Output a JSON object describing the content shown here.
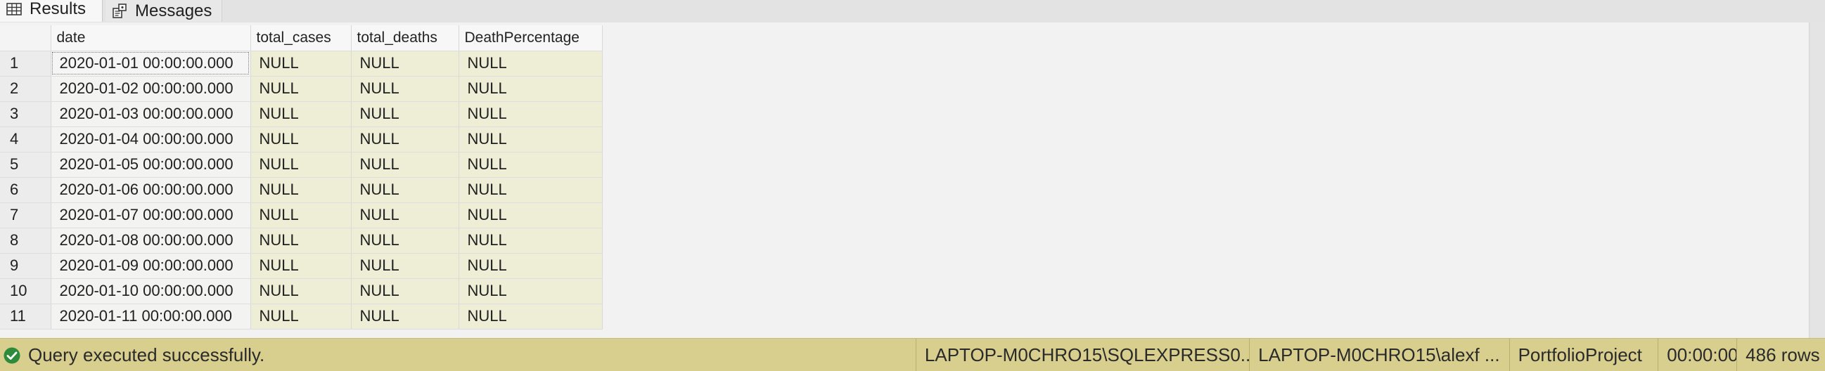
{
  "tabs": {
    "results_label": "Results",
    "messages_label": "Messages"
  },
  "grid": {
    "columns": [
      "date",
      "total_cases",
      "total_deaths",
      "DeathPercentage"
    ],
    "rows": [
      {
        "num": "1",
        "date": "2020-01-01 00:00:00.000",
        "total_cases": "NULL",
        "total_deaths": "NULL",
        "DeathPercentage": "NULL"
      },
      {
        "num": "2",
        "date": "2020-01-02 00:00:00.000",
        "total_cases": "NULL",
        "total_deaths": "NULL",
        "DeathPercentage": "NULL"
      },
      {
        "num": "3",
        "date": "2020-01-03 00:00:00.000",
        "total_cases": "NULL",
        "total_deaths": "NULL",
        "DeathPercentage": "NULL"
      },
      {
        "num": "4",
        "date": "2020-01-04 00:00:00.000",
        "total_cases": "NULL",
        "total_deaths": "NULL",
        "DeathPercentage": "NULL"
      },
      {
        "num": "5",
        "date": "2020-01-05 00:00:00.000",
        "total_cases": "NULL",
        "total_deaths": "NULL",
        "DeathPercentage": "NULL"
      },
      {
        "num": "6",
        "date": "2020-01-06 00:00:00.000",
        "total_cases": "NULL",
        "total_deaths": "NULL",
        "DeathPercentage": "NULL"
      },
      {
        "num": "7",
        "date": "2020-01-07 00:00:00.000",
        "total_cases": "NULL",
        "total_deaths": "NULL",
        "DeathPercentage": "NULL"
      },
      {
        "num": "8",
        "date": "2020-01-08 00:00:00.000",
        "total_cases": "NULL",
        "total_deaths": "NULL",
        "DeathPercentage": "NULL"
      },
      {
        "num": "9",
        "date": "2020-01-09 00:00:00.000",
        "total_cases": "NULL",
        "total_deaths": "NULL",
        "DeathPercentage": "NULL"
      },
      {
        "num": "10",
        "date": "2020-01-10 00:00:00.000",
        "total_cases": "NULL",
        "total_deaths": "NULL",
        "DeathPercentage": "NULL"
      },
      {
        "num": "11",
        "date": "2020-01-11 00:00:00.000",
        "total_cases": "NULL",
        "total_deaths": "NULL",
        "DeathPercentage": "NULL"
      }
    ]
  },
  "status": {
    "message": "Query executed successfully.",
    "server": "LAPTOP-M0CHRO15\\SQLEXPRESS0...",
    "user": "LAPTOP-M0CHRO15\\alexf ...",
    "database": "PortfolioProject",
    "elapsed": "00:00:00",
    "rows": "486 rows"
  },
  "colors": {
    "status_bar": "#d8cf8f",
    "null_cell": "#eeeed6",
    "success_icon": "#2e8b3a"
  },
  "icons": {
    "results": "grid-icon",
    "messages": "messages-icon",
    "status": "check-circle-icon"
  }
}
